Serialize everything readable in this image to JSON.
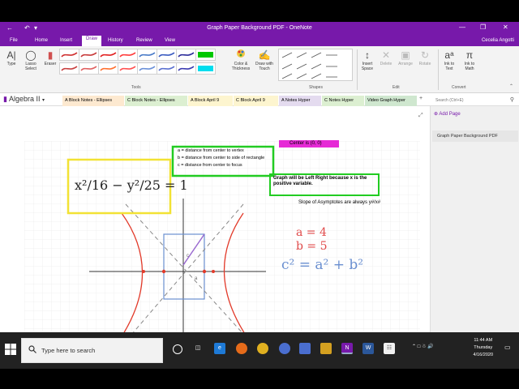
{
  "window": {
    "title": "Graph Paper Background PDF - OneNote",
    "user": "Cecelia Angotti"
  },
  "menu": [
    "File",
    "Home",
    "Insert",
    "Draw",
    "History",
    "Review",
    "View"
  ],
  "ribbon": {
    "tools": [
      {
        "icon": "text-cursor-icon",
        "label": "Type"
      },
      {
        "icon": "lasso-icon",
        "label": "Lasso Select"
      },
      {
        "icon": "eraser-icon",
        "label": "Eraser"
      }
    ],
    "color_thickness": "Color & Thickness",
    "draw_with_touch": "Draw with Touch",
    "insert_space": "Insert Space",
    "delete": "Delete",
    "arrange": "Arrange",
    "rotate": "Rotate",
    "ink_to_text": "Ink to Text",
    "ink_to_math": "Ink to Math",
    "groups": {
      "tools": "Tools",
      "shapes": "Shapes",
      "edit": "Edit",
      "convert": "Convert"
    },
    "pen_colors": [
      "#d03030",
      "#c83a3a",
      "#e22020",
      "#ff3b3b",
      "#4a7bc8",
      "#3a5bc0",
      "#2b2b9a",
      "#00c800",
      "#c84040",
      "#e06060",
      "#ff7030",
      "#ff5050",
      "#6a90d8",
      "#5a70d0",
      "#3a3ab0",
      "#00ddee"
    ]
  },
  "notebook": "Algebra II",
  "section_tabs": [
    {
      "label": "A Block Notes - Ellipses",
      "color": "#fde9d0"
    },
    {
      "label": "C Block Notes - Ellipses",
      "color": "#dcefd1"
    },
    {
      "label": "A Block April 9",
      "color": "#fdf5cf"
    },
    {
      "label": "C Block April 9",
      "color": "#fdf5cf"
    },
    {
      "label": "A Notes Hyper",
      "color": "#e4dbef"
    },
    {
      "label": "C Notes Hyper",
      "color": "#dcefd1"
    },
    {
      "label": "Video Graph Hyper",
      "color": "#cfe7cf"
    }
  ],
  "search_placeholder": "Search (Ctrl+E)",
  "pages": {
    "add_label": "Add Page",
    "items": [
      "Graph Paper Background PDF"
    ]
  },
  "notes": {
    "center": "Center is (0, 0)",
    "defs": [
      "a =  distance from center to vertex",
      "b = distance from center to side of rectangle",
      "c = distance from center to focus"
    ],
    "graph_note": "Graph will be Left Right because x is the positive variable.",
    "slope_note": "Slope of Asymptotes are always y#/x#",
    "handwriting": {
      "equation": "x²/16 − y²/25 = 1",
      "a": "a = 4",
      "b": "b = 5",
      "c": "c² = a² + b²"
    }
  },
  "taskbar": {
    "search": "Type here to search",
    "time": "11:44 AM",
    "day": "Thursday",
    "date": "4/16/2020"
  }
}
